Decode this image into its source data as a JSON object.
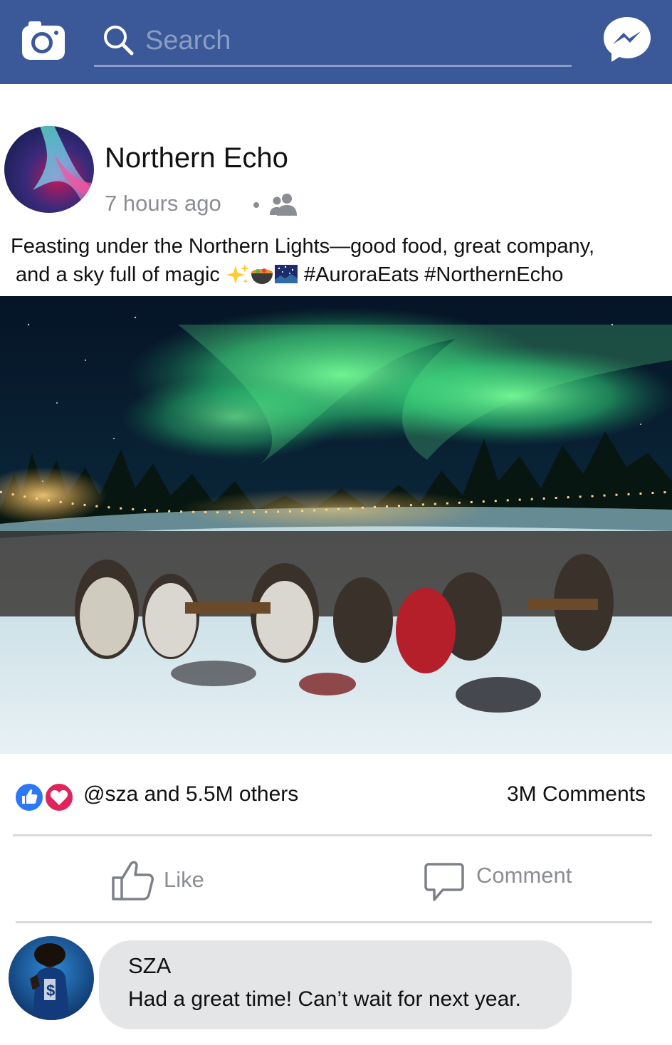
{
  "header": {
    "search_placeholder": "Search",
    "bar_color": "#3b5998",
    "icons": [
      "camera-icon",
      "search-icon",
      "messenger-icon"
    ]
  },
  "post": {
    "author": "Northern Echo",
    "timestamp": "7 hours ago",
    "audience_icon": "friends-icon",
    "caption_line1": "Feasting under the Northern Lights—good food, great company,",
    "caption_line2": "and a sky full of magic",
    "caption_emojis": [
      "sparkles-emoji",
      "stew-emoji",
      "night-sky-emoji"
    ],
    "caption_hashtags": "#AuroraEats #NorthernEcho",
    "image_subject": "photo-aurora-feast"
  },
  "engagement": {
    "reaction_icons": [
      "like-reaction-icon",
      "love-reaction-icon"
    ],
    "likes_text": "@sza and 5.5M others",
    "comments_count": "3M Comments"
  },
  "actions": {
    "like_label": "Like",
    "comment_label": "Comment"
  },
  "comment": {
    "author": "SZA",
    "text": "Had a great time! Can’t wait for next year."
  }
}
